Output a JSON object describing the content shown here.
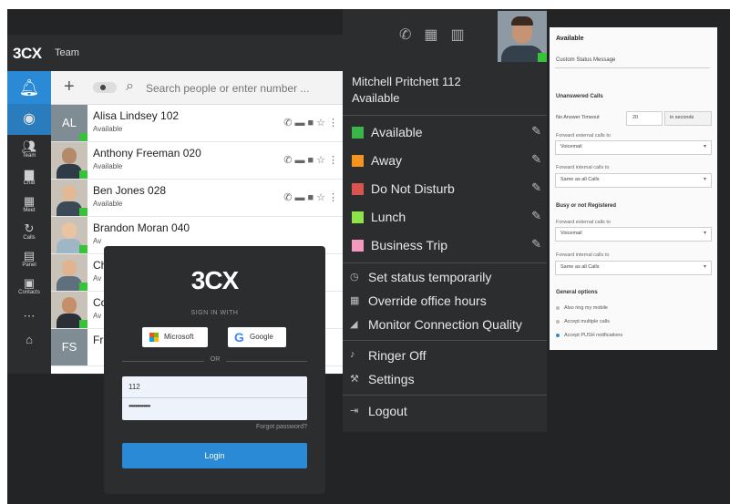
{
  "team_app": {
    "logo": "3CX",
    "title": "Team",
    "nav": [
      {
        "icon": "bell-icon",
        "label": ""
      },
      {
        "icon": "chrome-icon",
        "label": ""
      },
      {
        "icon": "team-icon",
        "label": "Team"
      },
      {
        "icon": "chat-icon",
        "label": "Chat"
      },
      {
        "icon": "meet-icon",
        "label": "Meet"
      },
      {
        "icon": "calls-icon",
        "label": "Calls"
      },
      {
        "icon": "panel-icon",
        "label": "Panel"
      },
      {
        "icon": "contacts-icon",
        "label": "Contacts"
      },
      {
        "icon": "more-icon",
        "label": ""
      },
      {
        "icon": "home-icon",
        "label": ""
      }
    ],
    "search_placeholder": "Search people or enter number ...",
    "contacts": [
      {
        "initials": "AL",
        "name": "Alisa Lindsey 102",
        "status": "Available"
      },
      {
        "initials": "",
        "name": "Anthony Freeman 020",
        "status": "Available"
      },
      {
        "initials": "",
        "name": "Ben Jones 028",
        "status": "Available"
      },
      {
        "initials": "",
        "name": "Brandon Moran 040",
        "status": "Av"
      },
      {
        "initials": "",
        "name": "Ch",
        "status": "Av"
      },
      {
        "initials": "",
        "name": "Co",
        "status": "Av"
      },
      {
        "initials": "FS",
        "name": "Fr",
        "status": ""
      }
    ]
  },
  "login": {
    "logo": "3CX",
    "sign_in_with": "SIGN IN WITH",
    "microsoft": "Microsoft",
    "google": "Google",
    "or": "OR",
    "username": "112",
    "password": "•••••••••••••",
    "forgot": "Forgot password?",
    "login_button": "Login"
  },
  "status_panel": {
    "name": "Mitchell Pritchett  112",
    "current_status": "Available",
    "statuses": [
      {
        "label": "Available",
        "color": "#39b54a"
      },
      {
        "label": "Away",
        "color": "#f7941d"
      },
      {
        "label": "Do Not Disturb",
        "color": "#d9534f"
      },
      {
        "label": "Lunch",
        "color": "#8ee34a"
      },
      {
        "label": "Business Trip",
        "color": "#f49ac1"
      }
    ],
    "menu": [
      {
        "icon": "clock-icon",
        "label": "Set status temporarily"
      },
      {
        "icon": "building-icon",
        "label": "Override office hours"
      },
      {
        "icon": "signal-icon",
        "label": "Monitor Connection Quality"
      },
      {
        "icon": "bell-off-icon",
        "label": "Ringer Off"
      },
      {
        "icon": "wrench-icon",
        "label": "Settings"
      },
      {
        "icon": "logout-icon",
        "label": "Logout"
      }
    ]
  },
  "settings": {
    "title": "Available",
    "custom_status_placeholder": "Custom Status Message",
    "unanswered_title": "Unanswered Calls",
    "no_answer_label": "No Answer Timeout",
    "no_answer_value": "20",
    "no_answer_unit": "in seconds",
    "fwd_external_label": "Forward external calls to",
    "fwd_external_value": "Voicemail",
    "fwd_internal_label": "Forward internal calls to",
    "fwd_internal_value": "Same as all Calls",
    "busy_title": "Busy or not Registered",
    "busy_external_label": "Forward external calls to",
    "busy_external_value": "Voicemail",
    "busy_internal_label": "Forward internal calls to",
    "busy_internal_value": "Same as all Calls",
    "general_title": "General options",
    "opt_ring_mobile": "Also ring my mobile",
    "opt_multiple_calls": "Accept multiple calls",
    "opt_push": "Accept PUSH notifications"
  }
}
